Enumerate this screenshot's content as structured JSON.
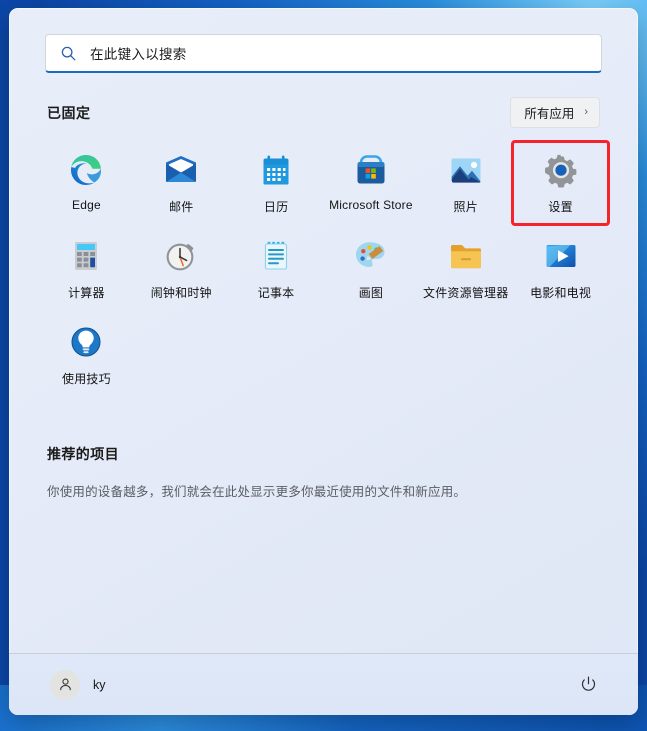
{
  "search": {
    "placeholder": "在此键入以搜索",
    "icon": "search-icon"
  },
  "pinned": {
    "title": "已固定",
    "all_apps_label": "所有应用",
    "all_apps_chevron": "›",
    "apps": [
      {
        "label": "Edge",
        "icon": "edge-icon",
        "highlighted": false
      },
      {
        "label": "邮件",
        "icon": "mail-icon",
        "highlighted": false
      },
      {
        "label": "日历",
        "icon": "calendar-icon",
        "highlighted": false
      },
      {
        "label": "Microsoft Store",
        "icon": "store-icon",
        "highlighted": false
      },
      {
        "label": "照片",
        "icon": "photos-icon",
        "highlighted": false
      },
      {
        "label": "设置",
        "icon": "settings-gear-icon",
        "highlighted": true
      },
      {
        "label": "计算器",
        "icon": "calculator-icon",
        "highlighted": false
      },
      {
        "label": "闹钟和时钟",
        "icon": "clock-icon",
        "highlighted": false
      },
      {
        "label": "记事本",
        "icon": "notepad-icon",
        "highlighted": false
      },
      {
        "label": "画图",
        "icon": "paint-palette-icon",
        "highlighted": false
      },
      {
        "label": "文件资源管理器",
        "icon": "folder-icon",
        "highlighted": false
      },
      {
        "label": "电影和电视",
        "icon": "movies-tv-icon",
        "highlighted": false
      },
      {
        "label": "使用技巧",
        "icon": "lightbulb-icon",
        "highlighted": false
      }
    ]
  },
  "recommended": {
    "title": "推荐的项目",
    "empty_text": "你使用的设备越多，我们就会在此处显示更多你最近使用的文件和新应用。"
  },
  "footer": {
    "user_name": "ky",
    "avatar_icon": "person-icon",
    "power_icon": "power-icon"
  },
  "colors": {
    "accent": "#1a69c4",
    "highlight_box": "#f5232b",
    "panel_bg": "#e4eaf7"
  }
}
